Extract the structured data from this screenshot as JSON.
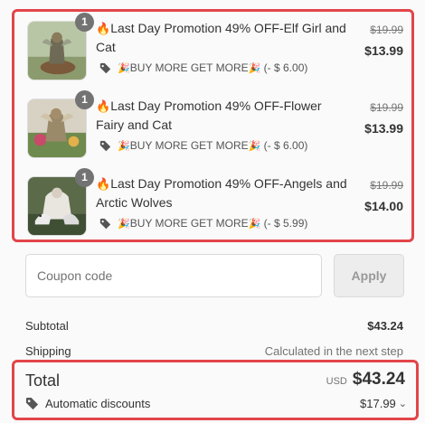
{
  "items": [
    {
      "quantity": "1",
      "flame": "🔥",
      "title": "Last Day Promotion 49% OFF-Elf Girl and Cat",
      "discount_prefix": "🎉",
      "discount_label": "BUY MORE GET MORE",
      "discount_suffix": "🎉",
      "discount_amount": "(- $ 6.00)",
      "original_price": "$19.99",
      "price": "$13.99"
    },
    {
      "quantity": "1",
      "flame": "🔥",
      "title": "Last Day Promotion 49% OFF-Flower Fairy and Cat",
      "discount_prefix": "🎉",
      "discount_label": "BUY MORE GET MORE",
      "discount_suffix": "🎉",
      "discount_amount": "(- $ 6.00)",
      "original_price": "$19.99",
      "price": "$13.99"
    },
    {
      "quantity": "1",
      "flame": "🔥",
      "title": "Last Day Promotion 49% OFF-Angels and Arctic Wolves",
      "discount_prefix": "🎉",
      "discount_label": "BUY MORE GET MORE",
      "discount_suffix": "🎉",
      "discount_amount": "(- $ 5.99)",
      "original_price": "$19.99",
      "price": "$14.00"
    }
  ],
  "coupon": {
    "placeholder": "Coupon code",
    "apply_label": "Apply"
  },
  "summary": {
    "subtotal_label": "Subtotal",
    "subtotal_value": "$43.24",
    "shipping_label": "Shipping",
    "shipping_value": "Calculated in the next step"
  },
  "total": {
    "label": "Total",
    "currency": "USD",
    "amount": "$43.24",
    "auto_discount_label": "Automatic discounts",
    "auto_discount_value": "$17.99"
  },
  "icons": {
    "tag": "tag-icon",
    "chevron": "chevron-down-icon"
  },
  "colors": {
    "highlight_border": "#e2454a",
    "qty_badge": "#737373"
  }
}
